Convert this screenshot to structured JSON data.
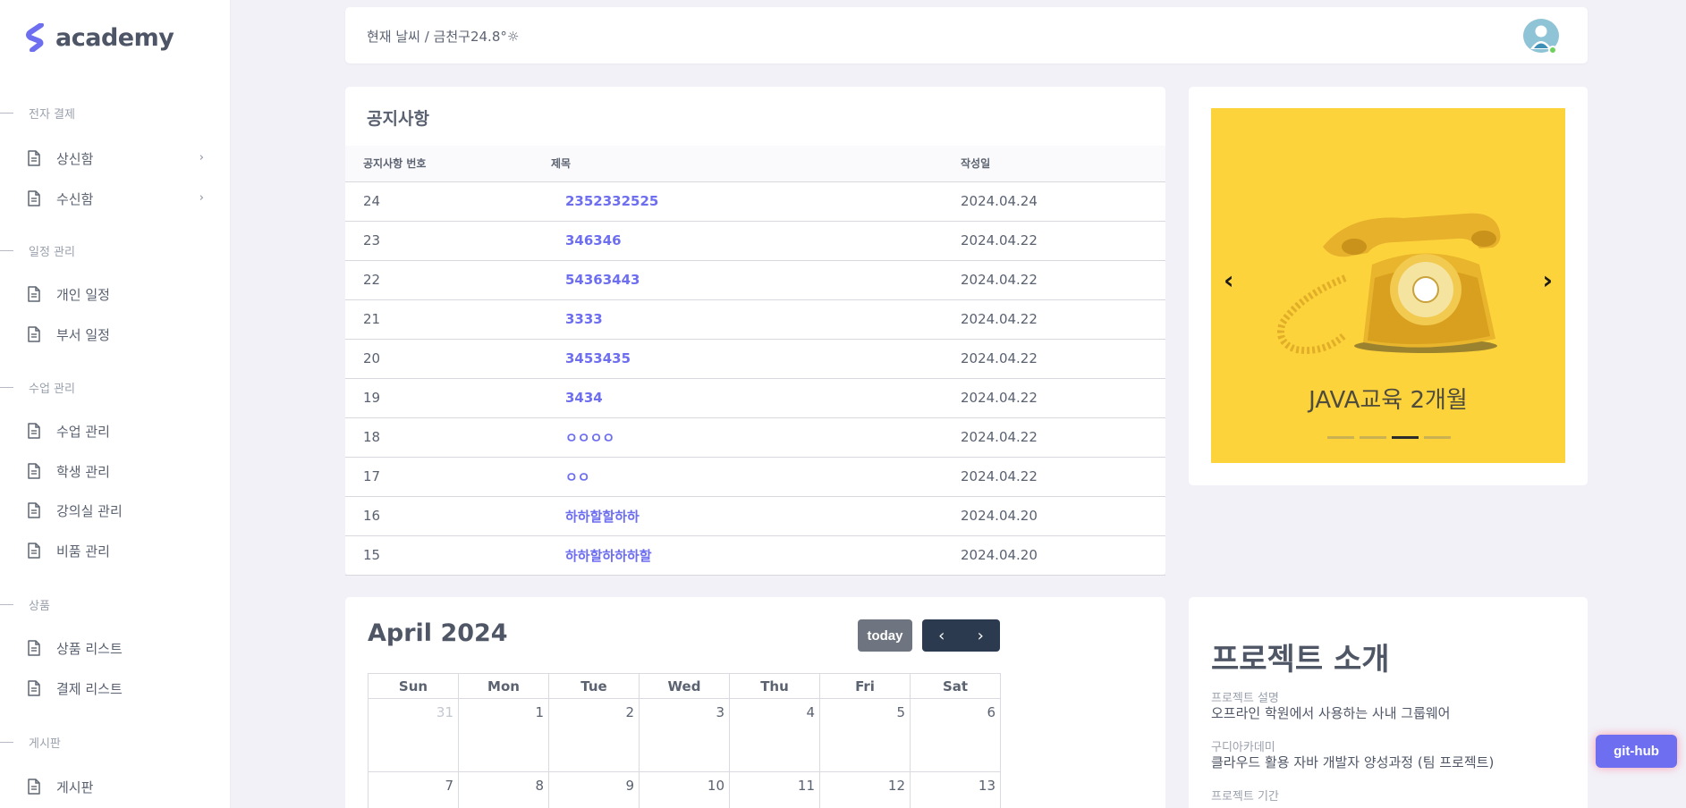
{
  "brand": {
    "name": "academy",
    "accent": "#6d6ef0"
  },
  "sidebar": {
    "sections": [
      {
        "title": "전자 결제",
        "items": [
          {
            "label": "상신함",
            "has_submenu": true
          },
          {
            "label": "수신함",
            "has_submenu": true
          }
        ]
      },
      {
        "title": "일정 관리",
        "items": [
          {
            "label": "개인 일정"
          },
          {
            "label": "부서 일정"
          }
        ]
      },
      {
        "title": "수업 관리",
        "items": [
          {
            "label": "수업 관리"
          },
          {
            "label": "학생 관리"
          },
          {
            "label": "강의실 관리"
          },
          {
            "label": "비품 관리"
          }
        ]
      },
      {
        "title": "상품",
        "items": [
          {
            "label": "상품 리스트"
          },
          {
            "label": "결제 리스트"
          }
        ]
      },
      {
        "title": "게시판",
        "items": [
          {
            "label": "게시판"
          }
        ]
      }
    ]
  },
  "header": {
    "weather": "현재 날씨 / 금천구24.8°☼",
    "avatar_icon": "user-avatar-icon"
  },
  "notice": {
    "title": "공지사항",
    "columns": [
      "공지사항 번호",
      "제목",
      "작성일"
    ],
    "rows": [
      {
        "no": "24",
        "title": "2352332525",
        "date": "2024.04.24"
      },
      {
        "no": "23",
        "title": "346346",
        "date": "2024.04.22"
      },
      {
        "no": "22",
        "title": "54363443",
        "date": "2024.04.22"
      },
      {
        "no": "21",
        "title": "3333",
        "date": "2024.04.22"
      },
      {
        "no": "20",
        "title": "3453435",
        "date": "2024.04.22"
      },
      {
        "no": "19",
        "title": "3434",
        "date": "2024.04.22"
      },
      {
        "no": "18",
        "title": "ㅇㅇㅇㅇ",
        "date": "2024.04.22"
      },
      {
        "no": "17",
        "title": "ㅇㅇ",
        "date": "2024.04.22"
      },
      {
        "no": "16",
        "title": "하하할할하하",
        "date": "2024.04.20"
      },
      {
        "no": "15",
        "title": "하하할하하하할",
        "date": "2024.04.20"
      }
    ]
  },
  "carousel": {
    "caption": "JAVA교육 2개월",
    "slides": 4,
    "active_slide": 3,
    "background": "#fdd33c"
  },
  "calendar": {
    "title": "April 2024",
    "today_label": "today",
    "weekdays": [
      "Sun",
      "Mon",
      "Tue",
      "Wed",
      "Thu",
      "Fri",
      "Sat"
    ],
    "weeks": [
      [
        {
          "d": "31",
          "other": true
        },
        {
          "d": "1"
        },
        {
          "d": "2"
        },
        {
          "d": "3"
        },
        {
          "d": "4"
        },
        {
          "d": "5"
        },
        {
          "d": "6"
        }
      ],
      [
        {
          "d": "7"
        },
        {
          "d": "8"
        },
        {
          "d": "9"
        },
        {
          "d": "10"
        },
        {
          "d": "11"
        },
        {
          "d": "12"
        },
        {
          "d": "13"
        }
      ]
    ]
  },
  "project": {
    "title": "프로젝트 소개",
    "fields": [
      {
        "label": "프로젝트 설명",
        "value": "오프라인 학원에서 사용하는 사내 그룹웨어"
      },
      {
        "label": "구디아카데미",
        "value": "클라우드 활용 자바 개발자 양성과정 (팀 프로젝트)"
      },
      {
        "label": "프로젝트 기간",
        "value": ""
      }
    ]
  },
  "github_label": "git-hub"
}
